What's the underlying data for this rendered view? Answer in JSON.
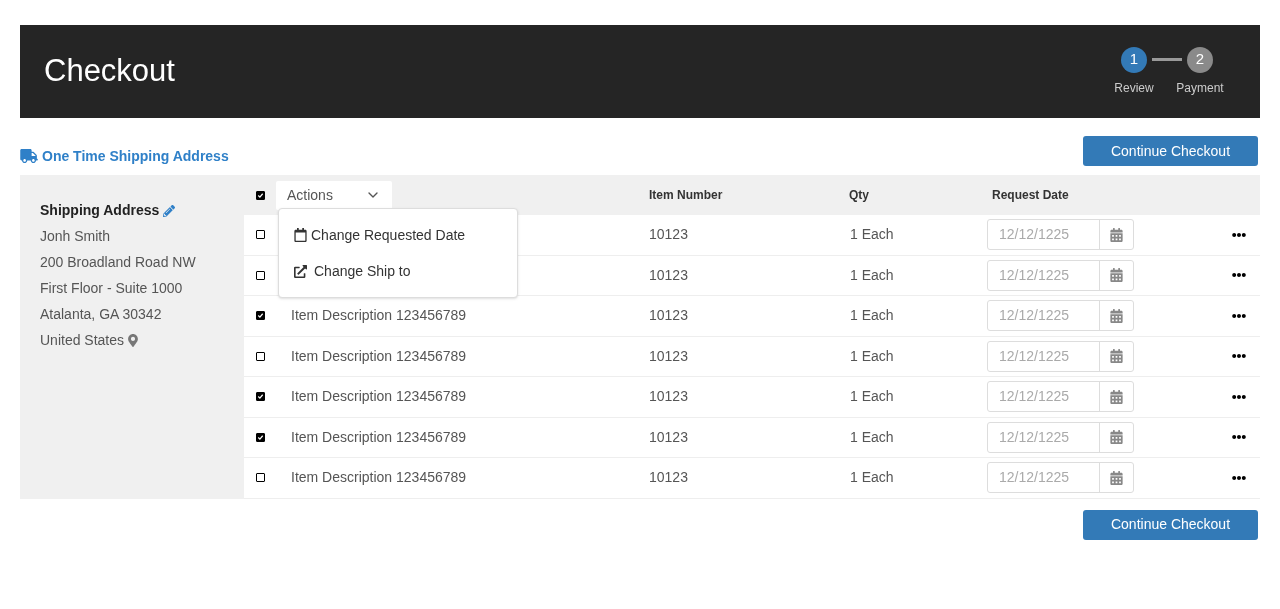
{
  "header": {
    "title": "Checkout",
    "steps": [
      {
        "number": "1",
        "label": "Review",
        "selected": true
      },
      {
        "number": "2",
        "label": "Payment",
        "selected": false
      }
    ]
  },
  "address_link": "One Time Shipping Address",
  "continue_buttons": [
    "Continue Checkout",
    "Continue Checkout"
  ],
  "shipping": {
    "title": "Shipping Address",
    "lines": [
      "Jonh Smith",
      "200 Broadland Road NW",
      "First Floor - Suite 1000",
      "Atalanta, GA 30342",
      "United States"
    ]
  },
  "table": {
    "select_all": {
      "checked": true
    },
    "actions": {
      "label": "Actions",
      "expanded": true,
      "items": [
        {
          "kind": "date",
          "label": "Change Requested Date"
        },
        {
          "kind": "ship",
          "label": "Change Ship to"
        }
      ]
    },
    "columns": [
      "Item Number",
      "Qty",
      "Request Date"
    ],
    "rows": [
      {
        "checked": false,
        "item_number": "10123",
        "qty": "1 Each",
        "date_placeholder": "12/12/1225"
      },
      {
        "checked": false,
        "item_number": "10123",
        "qty": "1 Each",
        "date_placeholder": "12/12/1225"
      },
      {
        "checked": true,
        "description": "Item Description 123456789",
        "item_number": "10123",
        "qty": "1 Each",
        "date_placeholder": "12/12/1225"
      },
      {
        "checked": false,
        "description": "Item Description 123456789",
        "item_number": "10123",
        "qty": "1 Each",
        "date_placeholder": "12/12/1225"
      },
      {
        "checked": true,
        "description": "Item Description 123456789",
        "item_number": "10123",
        "qty": "1 Each",
        "date_placeholder": "12/12/1225"
      },
      {
        "checked": true,
        "description": "Item Description 123456789",
        "item_number": "10123",
        "qty": "1 Each",
        "date_placeholder": "12/12/1225"
      },
      {
        "checked": false,
        "description": "Item Description 123456789",
        "item_number": "10123",
        "qty": "1 Each",
        "date_placeholder": "12/12/1225"
      }
    ]
  }
}
